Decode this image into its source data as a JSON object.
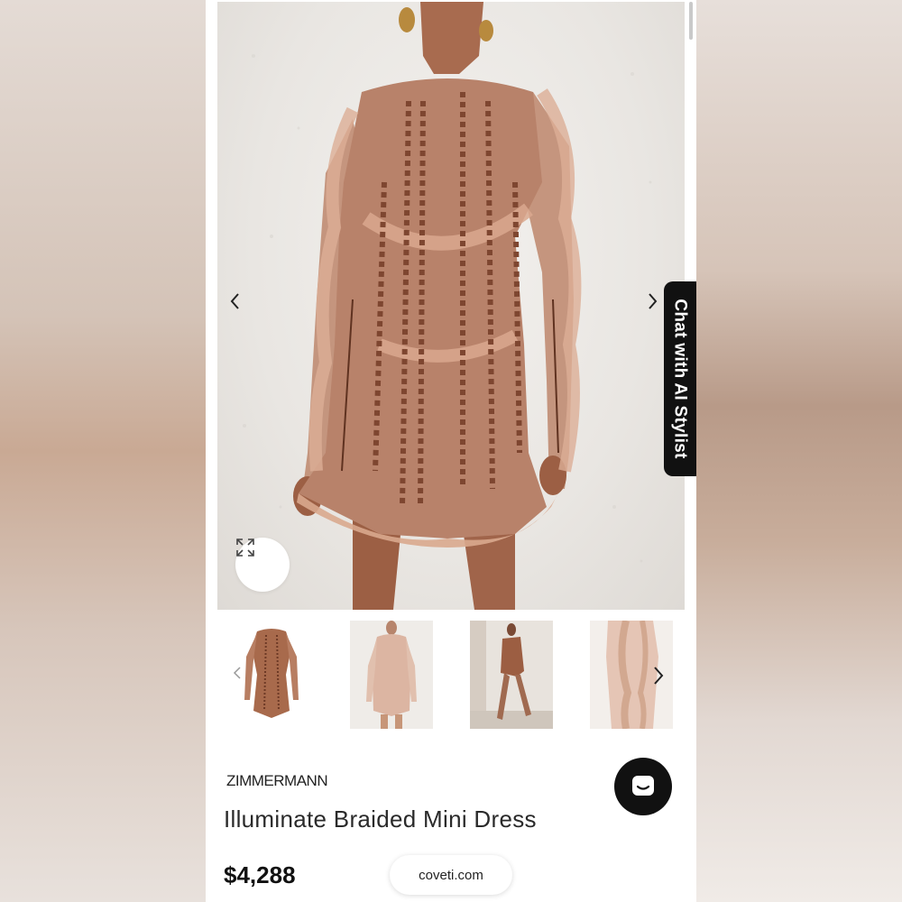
{
  "product": {
    "brand": "ZIMMERMANN",
    "name": "Illuminate Braided Mini Dress",
    "price": "$4,288"
  },
  "chat_tab": {
    "label": "Chat with AI Stylist"
  },
  "site_pill": {
    "label": "coveti.com"
  },
  "gallery": {
    "icons": {
      "prev": "chevron-left-icon",
      "next": "chevron-right-icon",
      "expand": "expand-icon",
      "support": "chat-bubble-icon"
    },
    "thumbnails": [
      {
        "name": "thumbnail-flat-lay"
      },
      {
        "name": "thumbnail-front-view"
      },
      {
        "name": "thumbnail-side-walking"
      },
      {
        "name": "thumbnail-back-detail"
      }
    ]
  },
  "colors": {
    "dress": "#b8826a",
    "dress_dark": "#8a5238",
    "wall": "#ece9e5",
    "ink": "#111111"
  }
}
